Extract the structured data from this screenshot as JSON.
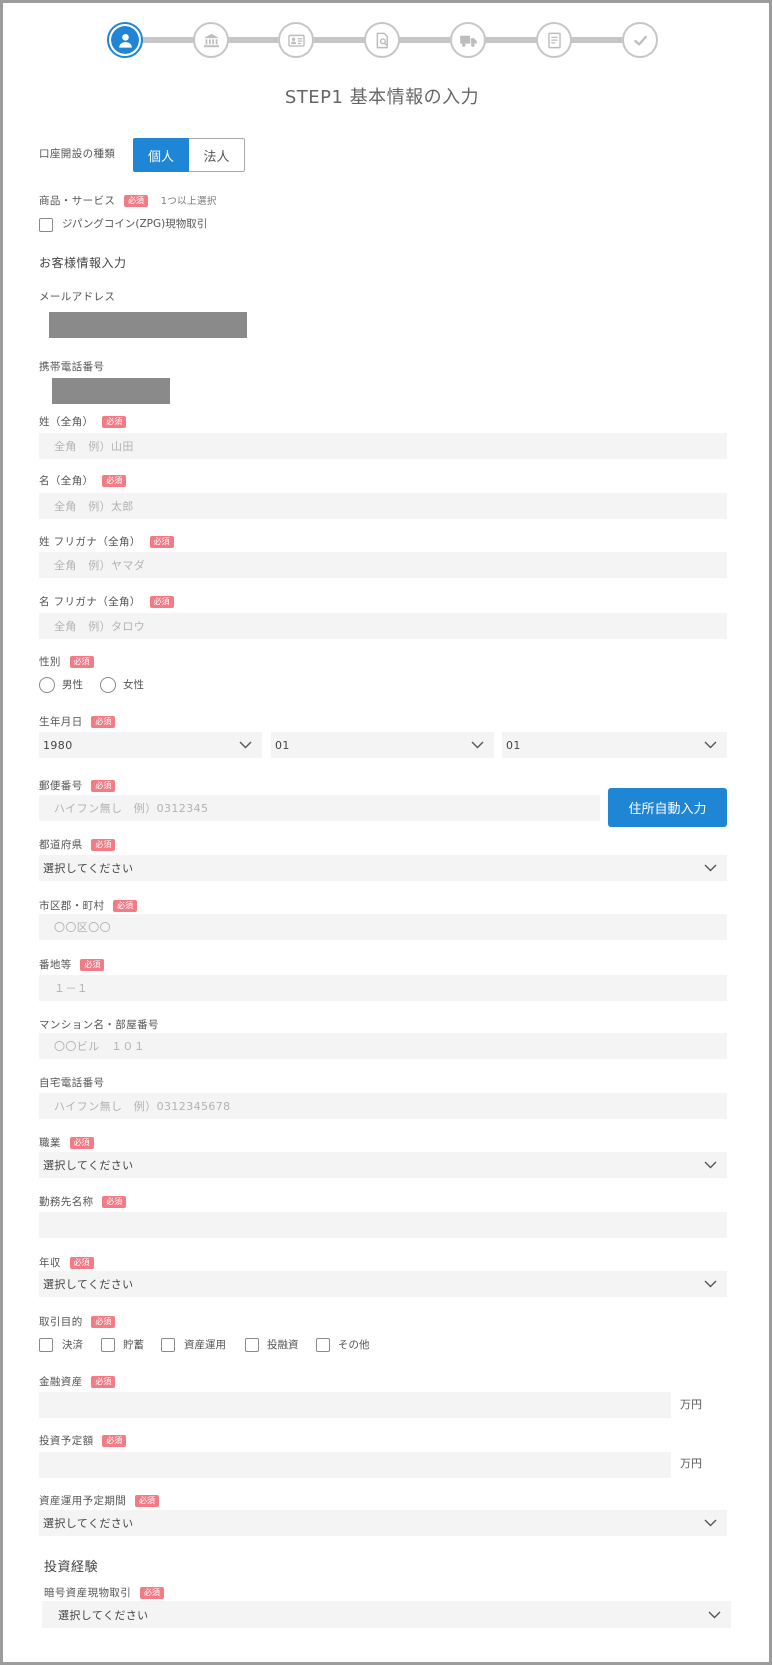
{
  "colors": {
    "accent": "#1e86d5",
    "badge": "#f27b86",
    "step_inactive": "#c6c6c6",
    "input_bg": "#f4f4f4"
  },
  "steps": [
    {
      "icon": "user-icon",
      "active": true
    },
    {
      "icon": "bank-icon",
      "active": false
    },
    {
      "icon": "id-card-icon",
      "active": false
    },
    {
      "icon": "document-search-icon",
      "active": false
    },
    {
      "icon": "truck-icon",
      "active": false
    },
    {
      "icon": "document-icon",
      "active": false
    },
    {
      "icon": "check-icon",
      "active": false
    }
  ],
  "page_title": "STEP1 基本情報の入力",
  "required_badge": "必須",
  "account_type": {
    "label": "口座開設の種類",
    "options": [
      {
        "label": "個人",
        "selected": true
      },
      {
        "label": "法人",
        "selected": false
      }
    ]
  },
  "products": {
    "label": "商品・サービス",
    "hint": "1つ以上選択",
    "options": [
      {
        "label": "ジパングコイン(ZPG)現物取引",
        "checked": false
      }
    ]
  },
  "customer_section": {
    "title": "お客様情報入力"
  },
  "email": {
    "label": "メールアドレス"
  },
  "mobile": {
    "label": "携帯電話番号"
  },
  "last_name": {
    "label": "姓（全角）",
    "placeholder": "全角　例）山田"
  },
  "first_name": {
    "label": "名（全角）",
    "placeholder": "全角　例）太郎"
  },
  "last_name_kana": {
    "label": "姓 フリガナ（全角）",
    "placeholder": "全角　例）ヤマダ"
  },
  "first_name_kana": {
    "label": "名 フリガナ（全角）",
    "placeholder": "全角　例）タロウ"
  },
  "gender": {
    "label": "性別",
    "options": [
      {
        "label": "男性",
        "selected": false
      },
      {
        "label": "女性",
        "selected": false
      }
    ]
  },
  "birth_date": {
    "label": "生年月日",
    "year": "1980",
    "month": "01",
    "day": "01"
  },
  "postal_code": {
    "label": "郵便番号",
    "placeholder": "ハイフン無し　例）0312345",
    "autofill_button": "住所自動入力"
  },
  "prefecture": {
    "label": "都道府県",
    "selected": "選択してください"
  },
  "city": {
    "label": "市区郡・町村",
    "placeholder": "〇〇区〇〇"
  },
  "street": {
    "label": "番地等",
    "placeholder": "１－１"
  },
  "building": {
    "label": "マンション名・部屋番号",
    "placeholder": "〇〇ビル　１０１"
  },
  "home_phone": {
    "label": "自宅電話番号",
    "placeholder": "ハイフン無し　例）0312345678"
  },
  "occupation": {
    "label": "職業",
    "selected": "選択してください"
  },
  "employer": {
    "label": "勤務先名称"
  },
  "annual_income": {
    "label": "年収",
    "selected": "選択してください"
  },
  "purpose": {
    "label": "取引目的",
    "options": [
      {
        "label": "決済",
        "checked": false
      },
      {
        "label": "貯蓄",
        "checked": false
      },
      {
        "label": "資産運用",
        "checked": false
      },
      {
        "label": "投融資",
        "checked": false
      },
      {
        "label": "その他",
        "checked": false
      }
    ]
  },
  "financial_assets": {
    "label": "金融資産",
    "unit": "万円"
  },
  "planned_investment": {
    "label": "投資予定額",
    "unit": "万円"
  },
  "investment_period": {
    "label": "資産運用予定期間",
    "selected": "選択してください"
  },
  "experience_section": {
    "title": "投資経験"
  },
  "crypto_spot": {
    "label": "暗号資産現物取引",
    "selected": "選択してください"
  }
}
